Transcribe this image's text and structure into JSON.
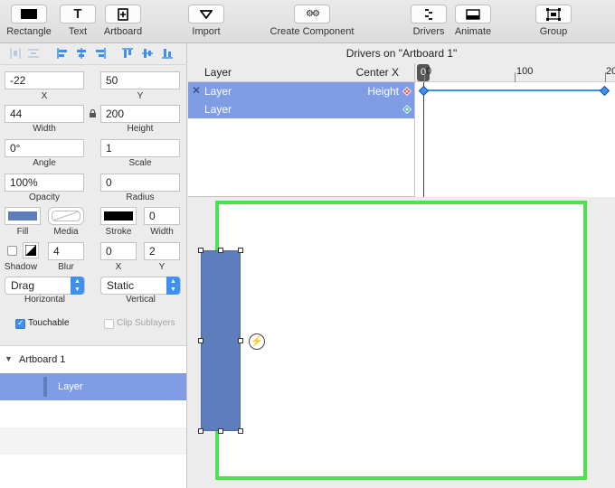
{
  "toolbar": {
    "items": [
      {
        "label": "Rectangle",
        "icon": "rectangle-icon"
      },
      {
        "label": "Text",
        "icon": "text-icon"
      },
      {
        "label": "Artboard",
        "icon": "artboard-icon"
      },
      {
        "label": "Import",
        "icon": "import-icon"
      },
      {
        "label": "Create Component",
        "icon": "component-gear-icon"
      },
      {
        "label": "Drivers",
        "icon": "drivers-icon"
      },
      {
        "label": "Animate",
        "icon": "animate-icon"
      },
      {
        "label": "Group",
        "icon": "group-icon"
      }
    ]
  },
  "inspector": {
    "x": {
      "value": "-22",
      "label": "X"
    },
    "y": {
      "value": "50",
      "label": "Y"
    },
    "width": {
      "value": "44",
      "label": "Width"
    },
    "height": {
      "value": "200",
      "label": "Height"
    },
    "angle": {
      "value": "0°",
      "label": "Angle"
    },
    "scale": {
      "value": "1",
      "label": "Scale"
    },
    "opacity": {
      "value": "100%",
      "label": "Opacity"
    },
    "radius": {
      "value": "0",
      "label": "Radius"
    },
    "fill": {
      "label": "Fill",
      "color": "#5d7dbd"
    },
    "media": {
      "label": "Media"
    },
    "stroke": {
      "label": "Stroke",
      "color": "#000000"
    },
    "stroke_width": {
      "value": "0",
      "label": "Width"
    },
    "shadow": {
      "label": "Shadow"
    },
    "blur": {
      "value": "4",
      "label": "Blur"
    },
    "shadow_x": {
      "value": "0",
      "label": "X"
    },
    "shadow_y": {
      "value": "2",
      "label": "Y"
    },
    "horizontal": {
      "value": "Drag",
      "label": "Horizontal"
    },
    "vertical": {
      "value": "Static",
      "label": "Vertical"
    },
    "touchable": {
      "label": "Touchable",
      "checked": true
    },
    "clip_sublayers": {
      "label": "Clip Sublayers",
      "checked": false
    }
  },
  "layers_panel": {
    "artboard": "Artboard 1",
    "layer": "Layer"
  },
  "drivers": {
    "title": "Drivers on \"Artboard 1\"",
    "col_layer": "Layer",
    "col_property": "Center X",
    "rows": [
      {
        "layer": "Layer",
        "property": "Height"
      },
      {
        "layer": "Layer",
        "property": ""
      }
    ],
    "ruler": {
      "marker": "0",
      "tick_0": "0",
      "tick_100": "100",
      "tick_200": "20"
    }
  },
  "colors": {
    "accent": "#3d8ff0",
    "selection": "#7f9ce4",
    "artboard_border": "#4be34b",
    "layer_fill": "#5d7dbd"
  }
}
